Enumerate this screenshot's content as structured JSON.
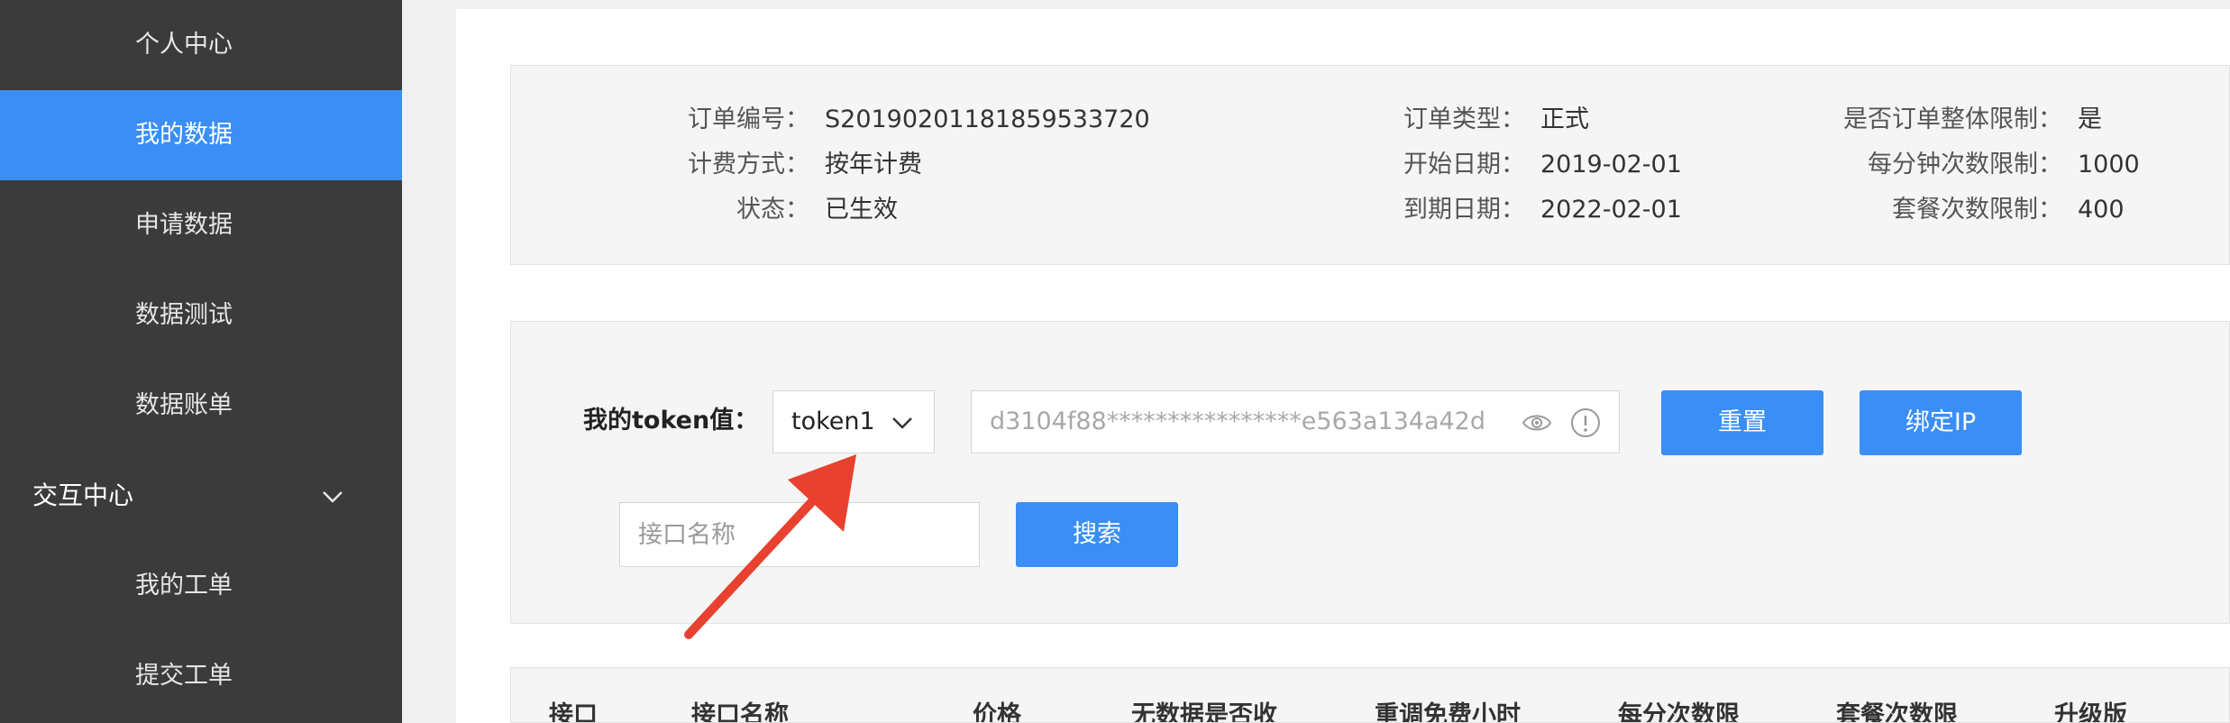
{
  "sidebar": {
    "items": [
      {
        "label": "个人中心"
      },
      {
        "label": "我的数据"
      },
      {
        "label": "申请数据"
      },
      {
        "label": "数据测试"
      },
      {
        "label": "数据账单"
      }
    ],
    "group": {
      "label": "交互中心"
    },
    "sub_items": [
      {
        "label": "我的工单"
      },
      {
        "label": "提交工单"
      }
    ]
  },
  "order": {
    "order_no_label": "订单编号：",
    "order_no": "S20190201181859533720",
    "billing_label": "计费方式：",
    "billing": "按年计费",
    "status_label": "状态：",
    "status": "已生效",
    "type_label": "订单类型：",
    "type": "正式",
    "start_label": "开始日期：",
    "start": "2019-02-01",
    "end_label": "到期日期：",
    "end": "2022-02-01",
    "whole_limit_label": "是否订单整体限制：",
    "whole_limit": "是",
    "per_minute_label": "每分钟次数限制：",
    "per_minute": "1000",
    "package_label": "套餐次数限制：",
    "package": "400"
  },
  "token": {
    "label": "我的token值：",
    "selected": "token1",
    "value": "d3104f88****************e563a134a42d",
    "reset_button": "重置",
    "bind_ip_button": "绑定IP"
  },
  "search": {
    "placeholder": "接口名称",
    "button": "搜索"
  },
  "table": {
    "headers": [
      "接口",
      "接口名称",
      "价格",
      "无数据是否收",
      "重调免费小时",
      "每分次数限",
      "套餐次数限",
      "升级版"
    ]
  },
  "colors": {
    "sidebar_bg": "#3b3b3b",
    "accent": "#3a8ef6",
    "arrow": "#e8412f"
  }
}
